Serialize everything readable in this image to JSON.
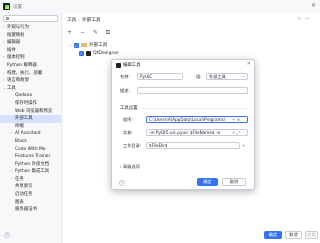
{
  "window": {
    "title": "设置"
  },
  "sidebar": {
    "items": [
      {
        "label": "外观与行为",
        "expand": "›",
        "level": 0
      },
      {
        "label": "按键映射",
        "expand": "",
        "level": 0
      },
      {
        "label": "编辑器",
        "expand": "›",
        "level": 0
      },
      {
        "label": "插件",
        "expand": "",
        "level": 0
      },
      {
        "label": "版本控制",
        "expand": "›",
        "level": 0
      },
      {
        "label": "Python 解释器",
        "expand": "",
        "level": 0
      },
      {
        "label": "构建、执行、部署",
        "expand": "›",
        "level": 0
      },
      {
        "label": "语言和框架",
        "expand": "›",
        "level": 0
      },
      {
        "label": "工具",
        "expand": "⌄",
        "level": 0
      },
      {
        "label": "Qodana",
        "expand": "",
        "level": 1
      },
      {
        "label": "保存时操作",
        "expand": "",
        "level": 1
      },
      {
        "label": "Web 浏览器和预览",
        "expand": "",
        "level": 1
      },
      {
        "label": "外部工具",
        "expand": "",
        "level": 1,
        "selected": true
      },
      {
        "label": "终端",
        "expand": "",
        "level": 1
      },
      {
        "label": "AI Assistant",
        "expand": "›",
        "level": 1
      },
      {
        "label": "Black",
        "expand": "",
        "level": 1
      },
      {
        "label": "Code With Me",
        "expand": "",
        "level": 1
      },
      {
        "label": "Features Trainer",
        "expand": "",
        "level": 1
      },
      {
        "label": "Python 外部文档",
        "expand": "",
        "level": 1
      },
      {
        "label": "Python 集成工具",
        "expand": "›",
        "level": 1
      },
      {
        "label": "任务",
        "expand": "›",
        "level": 1
      },
      {
        "label": "共享索引",
        "expand": "",
        "level": 1
      },
      {
        "label": "启动任务",
        "expand": "",
        "level": 1
      },
      {
        "label": "图表",
        "expand": "",
        "level": 1
      },
      {
        "label": "服务器证书",
        "expand": "",
        "level": 1
      }
    ]
  },
  "breadcrumb": {
    "first": "工具",
    "separator": "›",
    "second": "外部工具"
  },
  "toolbar": {
    "icons": "+ − ✎ ⧉"
  },
  "tree": {
    "group": "外部工具",
    "item": "QtDesigner",
    "check": "✓"
  },
  "dialog": {
    "title": "编辑工具",
    "close": "✕",
    "name_label": "名称:",
    "name_value": "PyUIC",
    "group_label": "组:",
    "group_value": "外部工具",
    "desc_label": "描述:",
    "desc_value": "",
    "settings_title": "工具设置",
    "program_label": "程序:",
    "program_value": "C:\\Users\\A\\AppData\\Local\\Programs\\",
    "args_label": "实参:",
    "args_value": "-m PyQt5.uic.pyuic $FileName$ -o",
    "workdir_label": "工作目录:",
    "workdir_value": "$FileDir$",
    "advanced_label": "高级选项",
    "ok_label": "确定",
    "cancel_label": "取消",
    "help": "?"
  },
  "footer": {
    "ok_label": "确定",
    "cancel_label": "取消",
    "apply_label": "应用",
    "help": "?"
  },
  "colors": {
    "accent": "#3574f0",
    "selected_bg": "#d5e1ff",
    "border": "#c9ccd6"
  }
}
